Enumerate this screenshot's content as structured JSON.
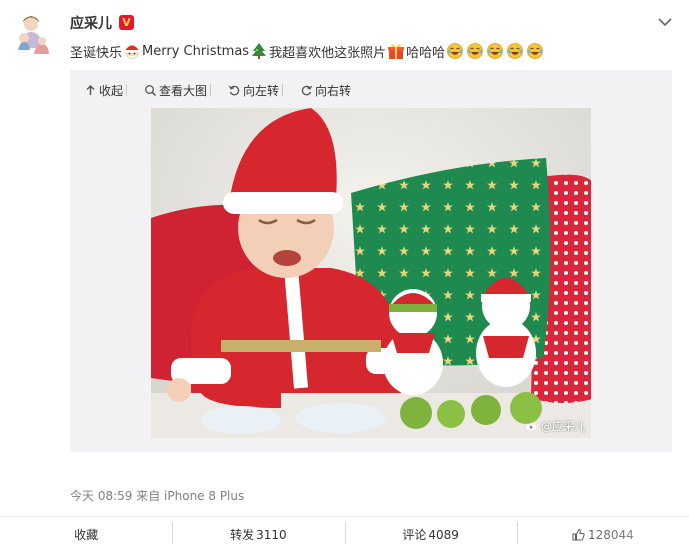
{
  "post": {
    "author": "应采儿",
    "verified_badge": "V",
    "text_parts": [
      "圣诞快乐",
      "Merry Christmas",
      "我超喜欢他这张照片",
      "哈哈哈"
    ],
    "emoji": [
      "santa-emoji",
      "christmas-tree-emoji",
      "gift-emoji",
      "laughing-emoji"
    ],
    "laugh_count": 5,
    "timestamp": "今天 08:59",
    "source": "来自 iPhone 8 Plus",
    "watermark": "@应采儿"
  },
  "media_toolbar": {
    "collapse": "收起",
    "view_large": "查看大图",
    "rotate_left": "向左转",
    "rotate_right": "向右转"
  },
  "actions": {
    "favorite": "收藏",
    "repost_label": "转发",
    "repost_count": "3110",
    "comment_label": "评论",
    "comment_count": "4089",
    "like_count": "128044"
  },
  "colors": {
    "accent_red": "#e6162d",
    "muted_text": "#808080",
    "media_bg": "#f2f2f5"
  }
}
